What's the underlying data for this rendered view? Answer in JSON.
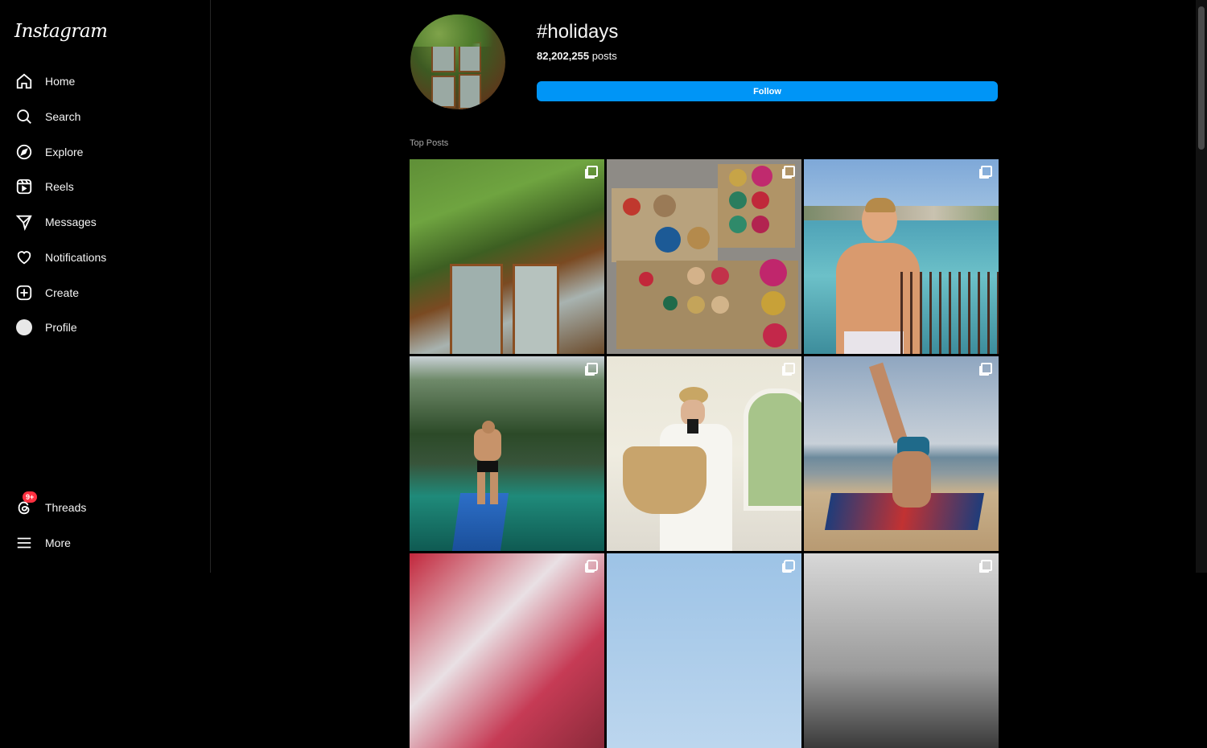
{
  "app": {
    "logo_text": "Instagram"
  },
  "sidebar": {
    "items": [
      {
        "label": "Home",
        "icon": "home-icon"
      },
      {
        "label": "Search",
        "icon": "search-icon"
      },
      {
        "label": "Explore",
        "icon": "compass-icon"
      },
      {
        "label": "Reels",
        "icon": "reels-icon"
      },
      {
        "label": "Messages",
        "icon": "send-icon"
      },
      {
        "label": "Notifications",
        "icon": "heart-icon"
      },
      {
        "label": "Create",
        "icon": "plus-square-icon"
      },
      {
        "label": "Profile",
        "icon": "avatar-icon"
      }
    ],
    "bottom": [
      {
        "label": "Threads",
        "icon": "threads-icon",
        "badge": "9+"
      },
      {
        "label": "More",
        "icon": "menu-icon"
      }
    ]
  },
  "hashtag": {
    "title": "#holidays",
    "post_count": "82,202,255",
    "post_label": "posts",
    "follow_label": "Follow"
  },
  "top_posts": {
    "label": "Top Posts",
    "posts": [
      {
        "name": "ivy-window",
        "icon": "carousel-icon"
      },
      {
        "name": "ornaments-box",
        "icon": "carousel-icon"
      },
      {
        "name": "beach-boy",
        "icon": "carousel-icon"
      },
      {
        "name": "lagoon-paddleboard",
        "icon": "carousel-icon"
      },
      {
        "name": "mirror-selfie",
        "icon": "carousel-icon"
      },
      {
        "name": "beach-headstand",
        "icon": "carousel-icon"
      },
      {
        "name": "post-7",
        "icon": "reels-icon"
      },
      {
        "name": "post-8",
        "icon": "reels-icon"
      },
      {
        "name": "post-9",
        "icon": "carousel-icon"
      }
    ]
  },
  "colors": {
    "accent": "#0095f6",
    "background": "#000000",
    "badge": "#ff3040"
  }
}
